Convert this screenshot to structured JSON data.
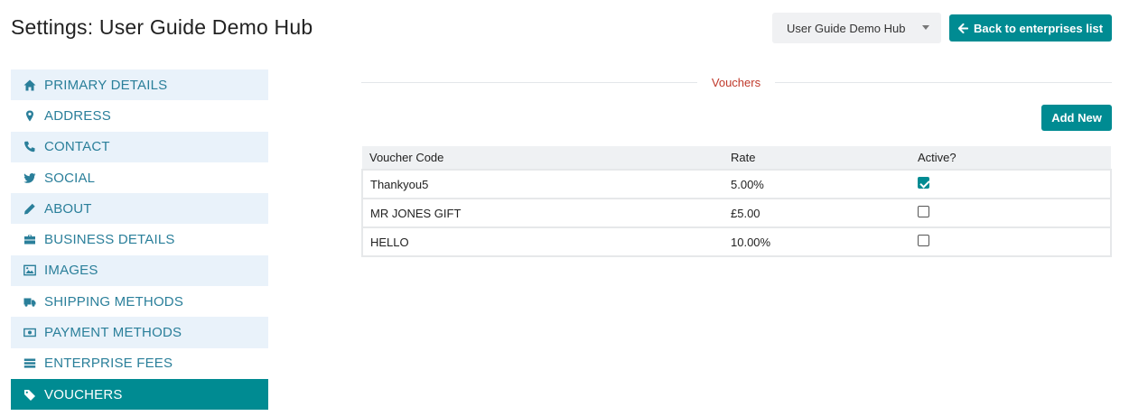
{
  "header": {
    "title": "Settings: User Guide Demo Hub",
    "hub_select_value": "User Guide Demo Hub",
    "back_label": "Back to enterprises list"
  },
  "sidebar": {
    "items": [
      {
        "label": "PRIMARY DETAILS",
        "icon": "home-icon"
      },
      {
        "label": "ADDRESS",
        "icon": "map-marker-icon"
      },
      {
        "label": "CONTACT",
        "icon": "phone-icon"
      },
      {
        "label": "SOCIAL",
        "icon": "twitter-icon"
      },
      {
        "label": "ABOUT",
        "icon": "pencil-icon"
      },
      {
        "label": "BUSINESS DETAILS",
        "icon": "briefcase-icon"
      },
      {
        "label": "IMAGES",
        "icon": "image-icon"
      },
      {
        "label": "SHIPPING METHODS",
        "icon": "truck-icon"
      },
      {
        "label": "PAYMENT METHODS",
        "icon": "money-icon"
      },
      {
        "label": "ENTERPRISE FEES",
        "icon": "fees-icon"
      },
      {
        "label": "VOUCHERS",
        "icon": "tags-icon"
      }
    ],
    "active_index": 10
  },
  "main": {
    "section_title": "Vouchers",
    "add_label": "Add New",
    "table": {
      "headers": [
        "Voucher Code",
        "Rate",
        "Active?"
      ],
      "rows": [
        {
          "code": "Thankyou5",
          "rate": "5.00%",
          "active": true
        },
        {
          "code": "MR JONES GIFT",
          "rate": "£5.00",
          "active": false
        },
        {
          "code": "HELLO",
          "rate": "10.00%",
          "active": false
        }
      ]
    }
  },
  "colors": {
    "accent": "#008b92",
    "sidebar_link": "#2a7f9a",
    "sidebar_alt_bg": "#e9f2fa",
    "section_title": "#c0392b"
  }
}
